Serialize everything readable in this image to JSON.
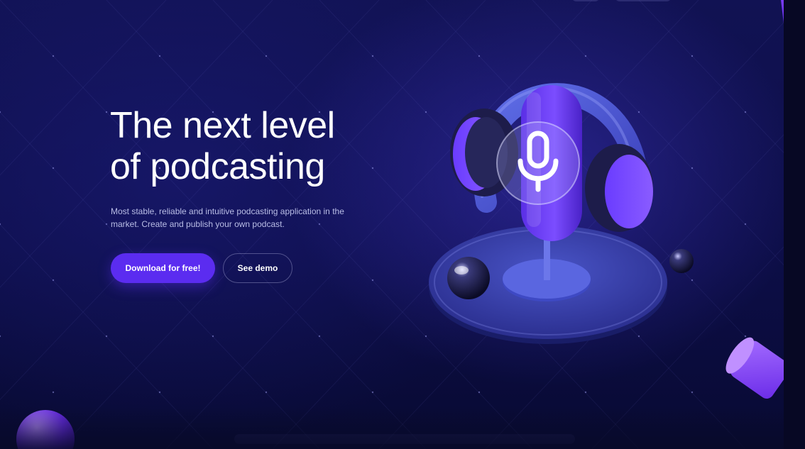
{
  "hero": {
    "headline_line1": "The next level",
    "headline_line2": "of podcasting",
    "description": "Most stable, reliable and intuitive podcasting application in the market. Create and publish your own podcast.",
    "primary_button": "Download for free!",
    "secondary_button": "See demo"
  },
  "theme": {
    "background": "#0d0e48",
    "accent": "#5b2cf0",
    "text": "#ffffff",
    "muted_text": "#b9bde6"
  },
  "icons": {
    "hero_illustration": "headphones-microphone-icon",
    "mic_symbol": "microphone-icon"
  }
}
